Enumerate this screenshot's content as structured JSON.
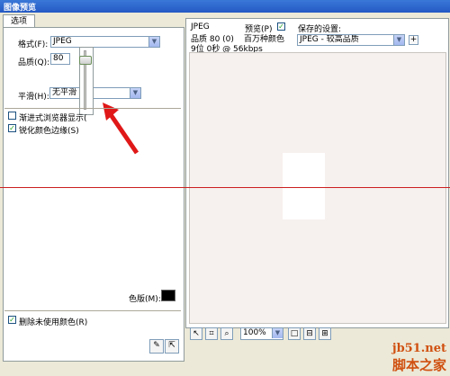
{
  "window": {
    "title": "图像预览"
  },
  "tabs": [
    {
      "label": "选项"
    }
  ],
  "options": {
    "format_label": "格式(F):",
    "format_value": "JPEG",
    "quality_label": "品质(Q):",
    "quality_value": "80",
    "smoothing_label": "平滑(H):",
    "smoothing_value": "无平滑",
    "progressive_label": "渐进式浏览器显示(",
    "sharpen_label": "锐化颜色边缘(S)",
    "matte_label": "色版(M):",
    "remove_unused_label": "删除未使用颜色(R)"
  },
  "preview_info": {
    "format": "JPEG",
    "quality_line": "品质 80 (0)",
    "size_line": "9位 0秒 @ 56kbps",
    "preview_label": "预览(P)",
    "colors_text": "百万种颜色",
    "saved_settings_label": "保存的设置:",
    "saved_settings_value": "JPEG - 较高品质",
    "add_symbol": "+"
  },
  "bottom_toolbar": {
    "zoom_value": "100%"
  },
  "watermark": {
    "line1": "jb51.net",
    "line2": "脚本之家"
  },
  "colors": {
    "titlebar": "#2459c4",
    "red_line": "#cc1f1f",
    "arrow": "#e01818",
    "preview_bg": "#f6f0ee"
  },
  "icons": [
    "pointer-icon",
    "crop-icon",
    "zoom-icon",
    "single-view-icon",
    "two-view-icon",
    "four-view-icon",
    "optimize-wand-icon",
    "export-icon",
    "checkmark-icon",
    "dropdown-arrow-icon"
  ]
}
